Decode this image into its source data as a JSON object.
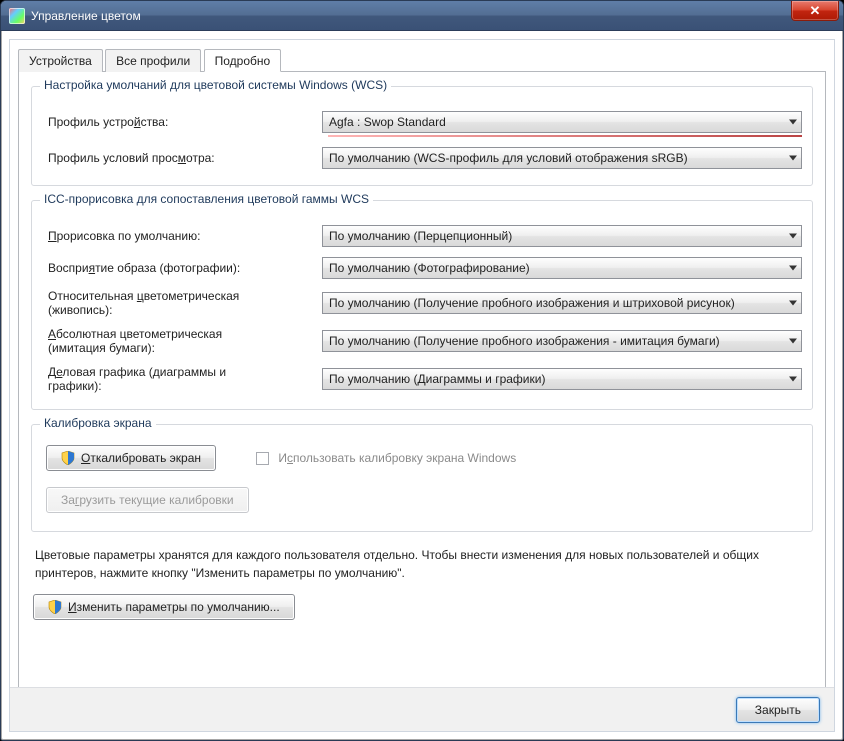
{
  "window": {
    "title": "Управление цветом"
  },
  "tabs": {
    "devices": "Устройства",
    "all_profiles": "Все профили",
    "advanced": "Подробно"
  },
  "group_wcs": {
    "legend": "Настройка умолчаний для цветовой системы Windows (WCS)",
    "device_profile_label": "Профиль устройства:",
    "device_profile_value": "Agfa : Swop Standard",
    "viewing_profile_label": "Профиль условий просмотра:",
    "viewing_profile_value": "По умолчанию (WCS-профиль для условий отображения sRGB)"
  },
  "group_icc": {
    "legend": "ICC-прорисовка для сопоставления цветовой гаммы WCS",
    "default_render_label": "Прорисовка по умолчанию:",
    "default_render_value": "По умолчанию (Перцепционный)",
    "perception_label": "Восприятие образа (фотографии):",
    "perception_value": "По умолчанию (Фотографирование)",
    "rel_color_label_1": "Относительная цветометрическая",
    "rel_color_label_2": "(живопись):",
    "rel_color_value": "По умолчанию (Получение пробного изображения и штриховой рисунок)",
    "abs_color_label_1": "Абсолютная цветометрическая",
    "abs_color_label_2": "(имитация бумаги):",
    "abs_color_value": "По умолчанию (Получение пробного изображения - имитация бумаги)",
    "business_label_1": "Деловая графика (диаграммы и",
    "business_label_2": "графики):",
    "business_value": "По умолчанию (Диаграммы и графики)"
  },
  "group_calib": {
    "legend": "Калибровка экрана",
    "calibrate_btn": "Откалибровать экран",
    "load_btn": "Загрузить текущие калибровки",
    "use_windows_calib": "Использовать калибровку экрана Windows"
  },
  "note_text": "Цветовые параметры хранятся для каждого пользователя отдельно. Чтобы внести изменения для новых пользователей и общих принтеров, нажмите кнопку \"Изменить параметры по умолчанию\".",
  "change_defaults_btn": "Изменить параметры по умолчанию...",
  "close_btn": "Закрыть"
}
